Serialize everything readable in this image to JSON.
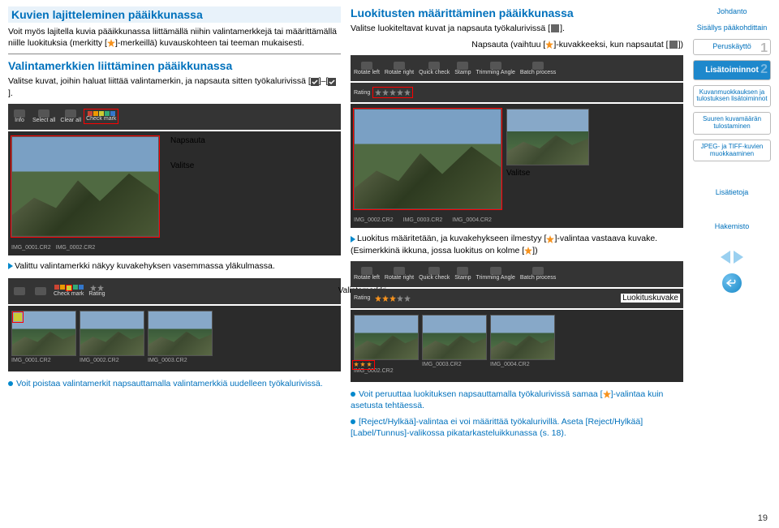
{
  "left": {
    "h1": "Kuvien lajitteleminen pääikkunassa",
    "p1a": "Voit myös lajitella kuvia pääikkunassa liittämällä niihin valintamerkkejä tai määrittämällä niille luokituksia (merkitty [",
    "p1b": "]-merkeillä) kuvauskohteen tai teeman mukaisesti.",
    "h2": "Valintamerkkien liittäminen pääikkunassa",
    "p2a": "Valitse kuvat, joihin haluat liittää valintamerkin, ja napsauta sitten työkalurivissä [",
    "p2b": "]–[",
    "p2c": "].",
    "label_napsauta": "Napsauta",
    "label_valitse": "Valitse",
    "note1": "Valittu valintamerkki näkyy kuvakehyksen vasemmassa yläkulmassa.",
    "label_valintamerkki": "Valintamerkki",
    "tip1": "Voit poistaa valintamerkit napsauttamalla valintamerkkiä uudelleen työkalurivissä."
  },
  "mid": {
    "h1": "Luokitusten määrittäminen pääikkunassa",
    "p1a": "Valitse luokiteltavat kuvat ja napsauta työkalurivissä [",
    "p1b": "].",
    "p2a": "Napsauta (vaihtuu [",
    "p2b": "]-kuvakkeeksi, kun napsautat [",
    "p2c": "])",
    "label_valitse": "Valitse",
    "note1a": "Luokitus määritetään, ja kuvakehykseen ilmestyy [",
    "note1b": "]-valintaa vastaava kuvake.",
    "note2a": "(Esimerkkinä ikkuna, jossa luokitus on kolme [",
    "note2b": "])",
    "label_luokituskuvake": "Luokituskuvake",
    "tip1a": "Voit peruuttaa luokituksen napsauttamalla työkalurivissä samaa [",
    "tip1b": "]-valintaa kuin asetusta tehtäessä.",
    "tip2": "[Reject/Hylkää]-valintaa ei voi määrittää työkalurivillä. Aseta [Reject/Hylkää] [Label/Tunnus]-valikossa pikatarkasteluikkunassa (s. 18)."
  },
  "toolbar": {
    "info": "Info",
    "select_all": "Select all",
    "clear_all": "Clear all",
    "rotate_left": "Rotate left",
    "rotate_right": "Rotate right",
    "check": "Check mark",
    "quick": "Quick check",
    "stamp": "Stamp",
    "trimming": "Trimming Angle",
    "batch": "Batch process",
    "rating": "Rating"
  },
  "thumbs": {
    "t1": "IMG_0001.CR2",
    "t2": "IMG_0002.CR2",
    "t3": "IMG_0003.CR2",
    "t4": "IMG_0004.CR2"
  },
  "nav": {
    "johdanto": "Johdanto",
    "sisallys": "Sisällys pääkohdittain",
    "peruskaytto": "Peruskäyttö",
    "lisatoiminnot": "Lisätoiminnot",
    "kuvanmuokkaus": "Kuvanmuokkauksen ja tulostuksen lisätoiminnot",
    "suuren": "Suuren kuvamäärän tulostaminen",
    "jpeg": "JPEG- ja TIFF-kuvien muokkaaminen",
    "lisatietoja": "Lisätietoja",
    "hakemisto": "Hakemisto",
    "n1": "1",
    "n2": "2"
  },
  "page_num": "19"
}
